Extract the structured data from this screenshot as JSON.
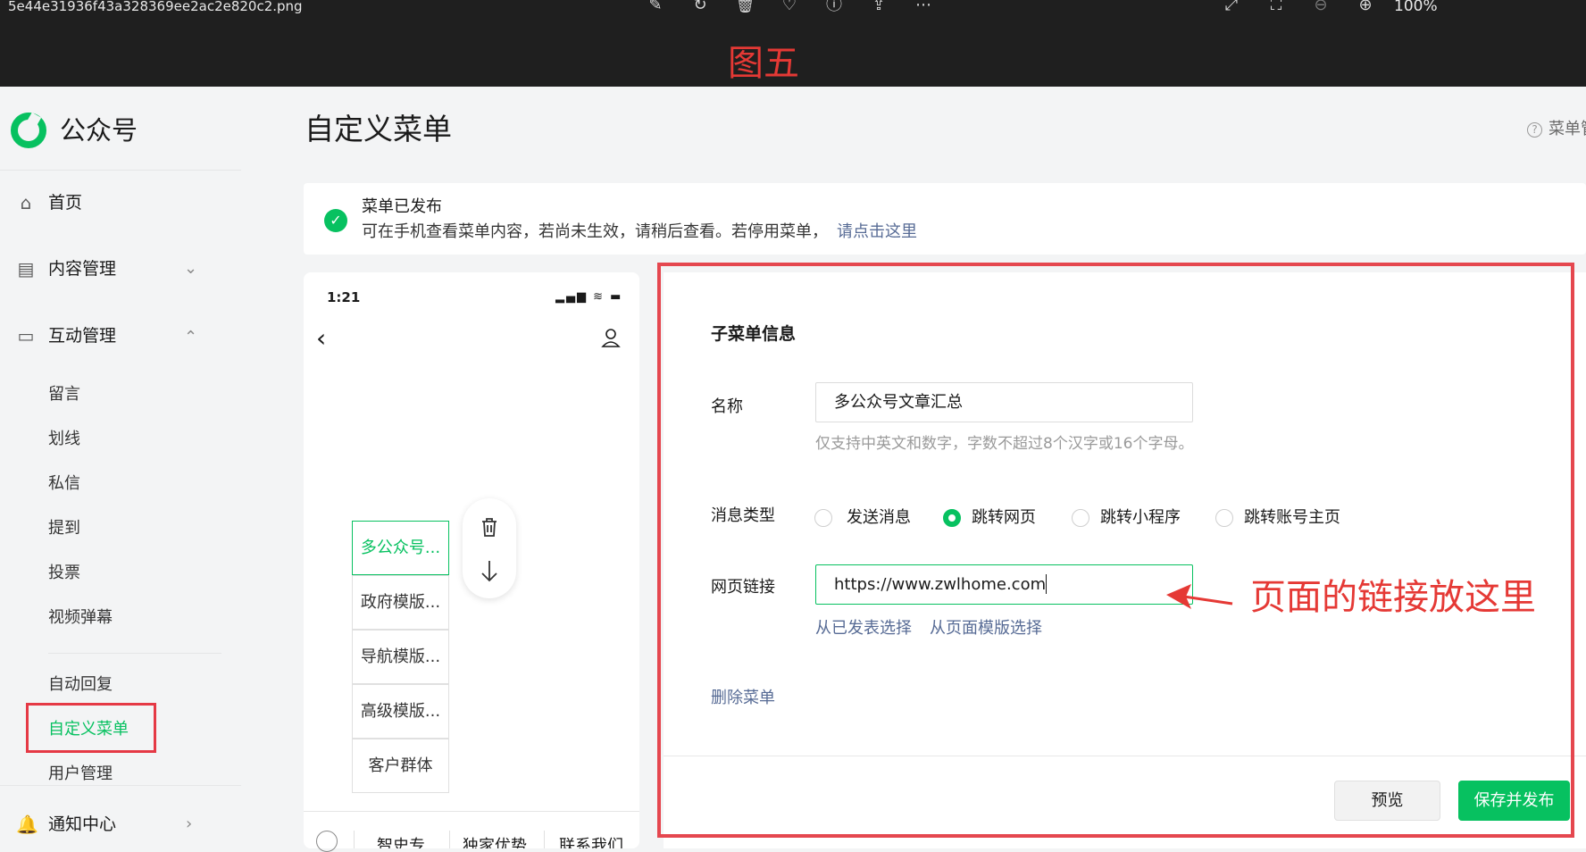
{
  "viewer": {
    "file_name": "5e44e31936f43a328369ee2ac2e820c2.png",
    "zoom": "100%",
    "annotation_title": "图五",
    "icons": [
      "edit-icon",
      "rotate-icon",
      "delete-icon",
      "favorite-icon",
      "info-icon",
      "share-icon",
      "more-icon",
      "expand-icon",
      "fit-screen-icon",
      "zoom-out-icon",
      "zoom-in-icon"
    ]
  },
  "app": {
    "name": "公众号"
  },
  "sidebar": {
    "home": "首页",
    "content": "内容管理",
    "interaction": "互动管理",
    "interaction_items": [
      "留言",
      "划线",
      "私信",
      "提到",
      "投票",
      "视频弹幕"
    ],
    "extra_items": [
      "自动回复",
      "自定义菜单",
      "用户管理"
    ],
    "notice_center": "通知中心"
  },
  "page": {
    "title": "自定义菜单",
    "help_link": "菜单管"
  },
  "notice": {
    "title": "菜单已发布",
    "desc": "可在手机查看菜单内容，若尚未生效，请稍后查看。若停用菜单，",
    "link": "请点击这里"
  },
  "phone": {
    "time": "1:21",
    "status": "▂▄▆ ≋ ▬",
    "back": "‹",
    "submenu_items": [
      "多公众号...",
      "政府模版...",
      "导航模版...",
      "高级模版...",
      "客户群体"
    ],
    "selected_index": 0,
    "bottom_tabs": [
      "智史专",
      "独家优势",
      "联系我们"
    ]
  },
  "form": {
    "heading": "子菜单信息",
    "name_label": "名称",
    "name_value": "多公众号文章汇总",
    "name_hint": "仅支持中英文和数字，字数不超过8个汉字或16个字母。",
    "type_label": "消息类型",
    "type_options": [
      "发送消息",
      "跳转网页",
      "跳转小程序",
      "跳转账号主页"
    ],
    "type_selected": "跳转网页",
    "url_label": "网页链接",
    "url_value": "https://www.zwlhome.com",
    "select_published": "从已发表选择",
    "select_template": "从页面模版选择",
    "delete_menu": "删除菜单",
    "preview": "预览",
    "save_publish": "保存并发布"
  },
  "annotation": {
    "arrow_text": "页面的链接放这里"
  },
  "colors": {
    "accent": "#07c160",
    "link": "#576b95",
    "annotation": "#e53935"
  }
}
